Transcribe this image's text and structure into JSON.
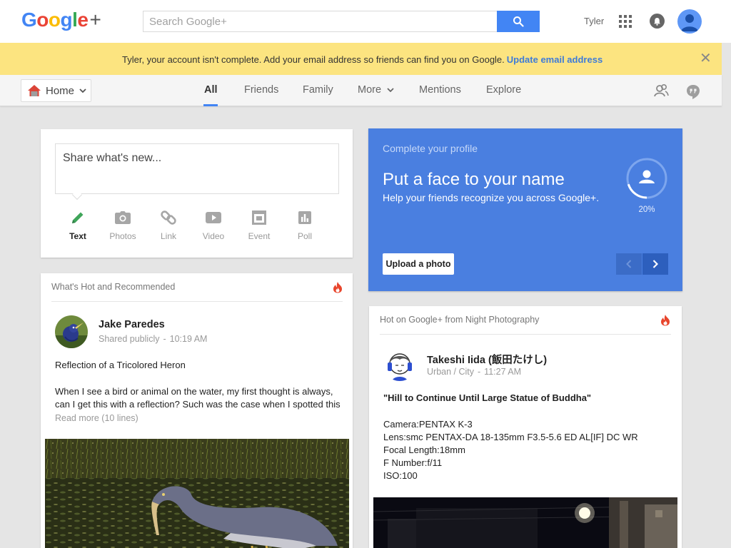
{
  "header": {
    "logo": {
      "g1": "G",
      "o1": "o",
      "o2": "o",
      "g2": "g",
      "l": "l",
      "e": "e",
      "plus": "+"
    },
    "search_placeholder": "Search Google+",
    "user_name": "Tyler",
    "icons": {
      "search": "search-icon",
      "apps": "apps-grid-icon",
      "notifications": "bell-icon",
      "avatar": "user-avatar-icon"
    }
  },
  "notice": {
    "text": "Tyler, your account isn't complete. Add your email address so friends can find you on Google.",
    "link": "Update email address",
    "close": "✕"
  },
  "nav": {
    "home_label": "Home",
    "tabs": [
      {
        "label": "All",
        "active": true
      },
      {
        "label": "Friends"
      },
      {
        "label": "Family"
      },
      {
        "label": "More"
      },
      {
        "label": "Mentions"
      },
      {
        "label": "Explore"
      }
    ],
    "icons": [
      "people-icon",
      "hangouts-icon"
    ]
  },
  "share": {
    "placeholder": "Share what's new...",
    "actions": [
      {
        "label": "Text",
        "icon": "pencil-icon",
        "active": true
      },
      {
        "label": "Photos",
        "icon": "camera-icon"
      },
      {
        "label": "Link",
        "icon": "link-icon"
      },
      {
        "label": "Video",
        "icon": "video-icon"
      },
      {
        "label": "Event",
        "icon": "event-icon"
      },
      {
        "label": "Poll",
        "icon": "poll-icon"
      }
    ]
  },
  "profile_card": {
    "kicker": "Complete your profile",
    "title": "Put a face to your name",
    "subtitle": "Help your friends recognize you across Google+.",
    "progress": "20%",
    "progress_value": 0.2,
    "upload_label": "Upload a photo",
    "color": "#4a7fe0"
  },
  "posts": [
    {
      "header": "What's Hot and Recommended",
      "author": "Jake Paredes",
      "visibility": "Shared publicly",
      "time": "10:19 AM",
      "title": "Reflection of a Tricolored Heron",
      "line1": "When I see a bird or animal on the water, my first thought is always,",
      "line2": "can I get this with a reflection? Such was the case when I spotted this",
      "read_more": "Read more (10 lines)"
    },
    {
      "header": "Hot on Google+ from Night Photography",
      "author": "Takeshi Iida (飯田たけし)",
      "visibility": "Urban / City",
      "time": "11:27 AM",
      "title": "\"Hill to Continue Until Large Statue of Buddha\"",
      "lines": [
        "Camera:PENTAX K-3",
        "Lens:smc PENTAX-DA 18-135mm F3.5-5.6 ED AL[IF] DC WR",
        "Focal Length:18mm",
        "F Number:f/11",
        "ISO:100"
      ]
    }
  ],
  "colors": {
    "accent": "#4285f4",
    "notice_bg": "#fce480",
    "link": "#3e7bd8",
    "flame": "#e8452c"
  }
}
